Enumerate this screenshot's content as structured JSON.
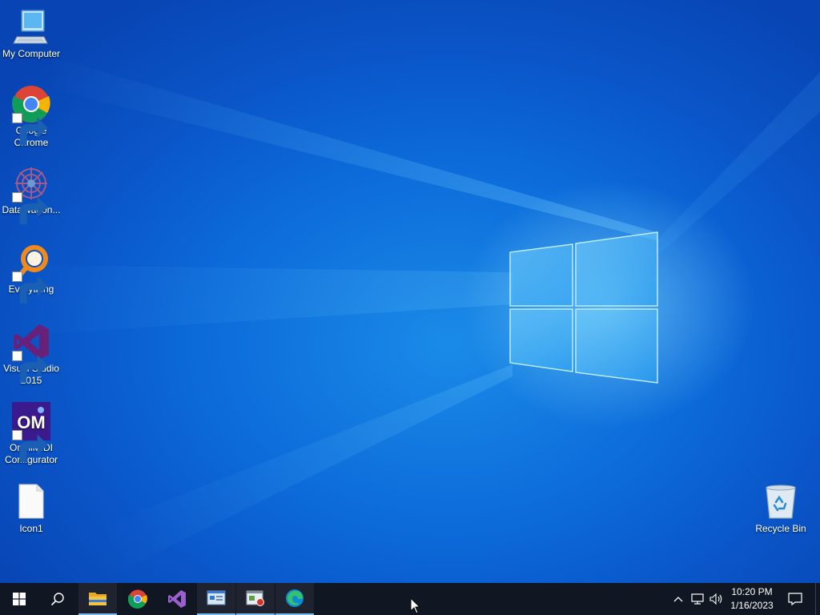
{
  "desktop": {
    "icons": [
      {
        "label": "My Computer",
        "icon": "computer-icon"
      },
      {
        "label": "Google Chrome",
        "icon": "chrome-icon"
      },
      {
        "label": "DataWagon...",
        "icon": "datawagon-icon"
      },
      {
        "label": "Everything",
        "icon": "everything-search-icon"
      },
      {
        "label": "Visual Studio 2015",
        "icon": "visual-studio-icon"
      },
      {
        "label": "OmniMIDI Configurator",
        "icon": "omnimidi-icon",
        "glyph_text": "OM"
      },
      {
        "label": "Icon1",
        "icon": "file-icon"
      },
      {
        "label": "Recycle Bin",
        "icon": "recycle-bin-icon"
      }
    ]
  },
  "taskbar": {
    "buttons": [
      {
        "icon": "start-windows-icon"
      },
      {
        "icon": "search-icon"
      },
      {
        "icon": "file-explorer-icon",
        "active": true
      },
      {
        "icon": "chrome-icon"
      },
      {
        "icon": "visual-studio-icon"
      },
      {
        "icon": "control-panel-icon",
        "active": true
      },
      {
        "icon": "screen-recorder-icon",
        "active": true
      },
      {
        "icon": "edge-icon",
        "active": true
      }
    ],
    "tray": {
      "icons": [
        "show-hidden-icons-chevron",
        "network-icon",
        "volume-icon",
        "notifications-icon"
      ],
      "time": "10:20 PM",
      "date": "1/16/2023"
    }
  },
  "colors": {
    "taskbar_bg": "#101622",
    "desktop_blue": "#0c6ad9",
    "active_indicator": "#76b9ed"
  }
}
